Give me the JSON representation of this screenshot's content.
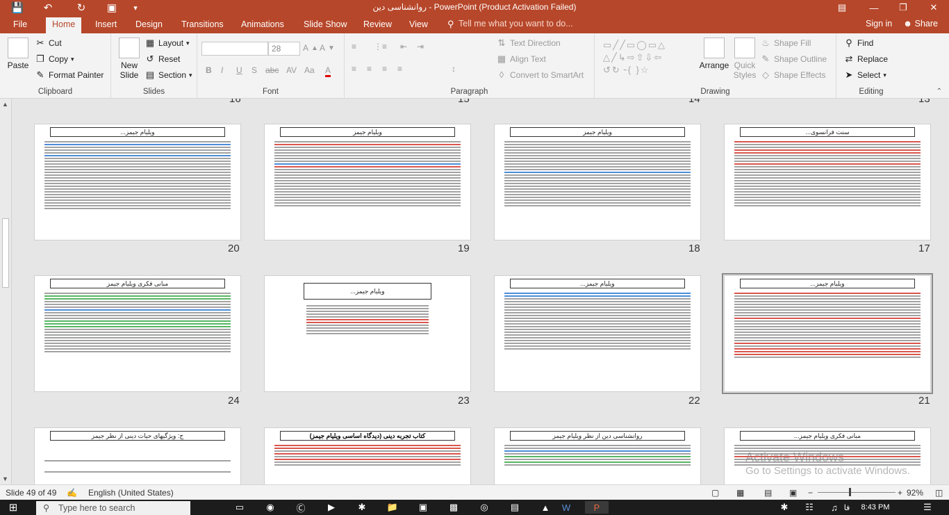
{
  "titlebar": {
    "title": "روانشناسی دین - PowerPoint (Product Activation Failed)",
    "save_icon": "save-icon",
    "undo_icon": "undo-icon",
    "redo_icon": "redo-icon",
    "present_icon": "present-icon"
  },
  "tabs": [
    "File",
    "Home",
    "Insert",
    "Design",
    "Transitions",
    "Animations",
    "Slide Show",
    "Review",
    "View"
  ],
  "active_tab": "Home",
  "tell_me": "Tell me what you want to do...",
  "sign_in": "Sign in",
  "share": "Share",
  "ribbon": {
    "clipboard": {
      "label": "Clipboard",
      "paste": "Paste",
      "cut": "Cut",
      "copy": "Copy",
      "format_painter": "Format Painter"
    },
    "slides": {
      "label": "Slides",
      "new_slide": "New Slide",
      "layout": "Layout",
      "reset": "Reset",
      "section": "Section"
    },
    "font": {
      "label": "Font",
      "font_name": "",
      "font_size": "28",
      "bold": "B",
      "italic": "I",
      "underline": "U",
      "strike": "S",
      "shadow": "abc",
      "spacing": "AV",
      "case": "Aa",
      "color": "A"
    },
    "paragraph": {
      "label": "Paragraph",
      "text_direction": "Text Direction",
      "align_text": "Align Text",
      "smartart": "Convert to SmartArt"
    },
    "drawing": {
      "label": "Drawing",
      "arrange": "Arrange",
      "quick_styles": "Quick Styles",
      "shape_fill": "Shape Fill",
      "shape_outline": "Shape Outline",
      "shape_effects": "Shape Effects"
    },
    "editing": {
      "label": "Editing",
      "find": "Find",
      "replace": "Replace",
      "select": "Select"
    }
  },
  "top_partial_numbers": [
    "16",
    "15",
    "14",
    "13"
  ],
  "slides_row1": [
    {
      "num": "20",
      "title": "ویلیام جیمز..."
    },
    {
      "num": "19",
      "title": "ویلیام جیمز"
    },
    {
      "num": "18",
      "title": "ویلیام جیمز"
    },
    {
      "num": "17",
      "title": "سنت فرانسوی..."
    }
  ],
  "slides_row2": [
    {
      "num": "24",
      "title": "مبانی فکری ویلیام جیمز"
    },
    {
      "num": "23",
      "title": "ویلیام جیمز..."
    },
    {
      "num": "22",
      "title": "ویلیام جیمز..."
    },
    {
      "num": "21",
      "title": "ویلیام جیمز..."
    }
  ],
  "slides_row3": [
    {
      "title": "ج: ویژگیهای حیات دینی از نظر جیمز"
    },
    {
      "title": "کتاب تجربه دینی (دیدگاه اساسی ویلیام جیمز)"
    },
    {
      "title": "روانشناسی دین از نظر ویلیام جیمز"
    },
    {
      "title": "مبانی فکری ویلیام جیمز..."
    }
  ],
  "selected_slide": "21",
  "status": {
    "slide": "Slide 49 of 49",
    "language": "English (United States)",
    "zoom": "92%"
  },
  "watermark": {
    "line1": "Activate Windows",
    "line2": "Go to Settings to activate Windows."
  },
  "taskbar": {
    "search_placeholder": "Type here to search",
    "time": "8:43 PM",
    "lang": "فا"
  }
}
